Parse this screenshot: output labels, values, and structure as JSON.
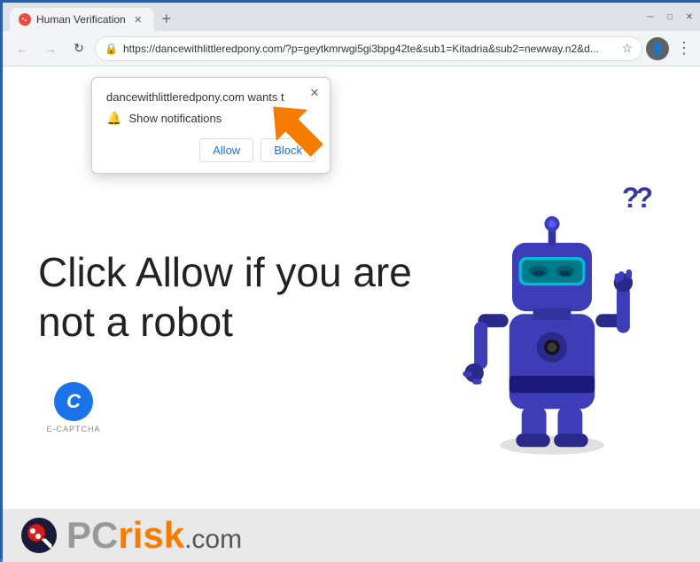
{
  "browser": {
    "title_bar": {
      "tab_label": "Human Verification",
      "new_tab_icon": "+",
      "close_icon": "✕",
      "minimize_icon": "─",
      "maximize_icon": "□",
      "window_close_icon": "✕"
    },
    "address_bar": {
      "url": "https://dancewithlittleredpony.com/?p=geytkmrwgi5gi3bpg42te&sub1=Kitadria&sub2=newway.n2&d...",
      "back_icon": "←",
      "forward_icon": "→",
      "reload_icon": "↻",
      "more_icon": "⋮"
    }
  },
  "notification_popup": {
    "title": "dancewithlittleredpony.com wants t",
    "notification_label": "Show notifications",
    "allow_button": "Allow",
    "block_button": "Block",
    "close_icon": "✕"
  },
  "page": {
    "main_text": "Click Allow if you are not a robot",
    "captcha_label": "E-CAPTCHA",
    "captcha_letter": "C"
  },
  "pcrisk": {
    "pc_text": "PC",
    "risk_text": "risk",
    "dotcom_text": ".com"
  },
  "colors": {
    "accent_blue": "#1a73e8",
    "robot_blue": "#3d3db8",
    "robot_dark": "#2a2a8a",
    "orange_arrow": "#f57c00",
    "teal_visor": "#00bcd4"
  }
}
